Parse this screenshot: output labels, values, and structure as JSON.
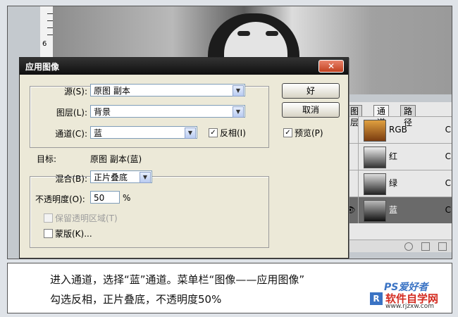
{
  "ruler_number": "6",
  "dialog": {
    "title": "应用图像",
    "close_glyph": "✕",
    "source_label": "源(S):",
    "source_value": "原图 副本",
    "layer_label": "图层(L):",
    "layer_value": "背景",
    "channel_label": "通道(C):",
    "channel_value": "蓝",
    "invert_label": "反相(I)",
    "invert_checked": true,
    "target_label": "目标:",
    "target_value": "原图 副本(蓝)",
    "blend_label": "混合(B):",
    "blend_value": "正片叠底",
    "opacity_label": "不透明度(O):",
    "opacity_value": "50",
    "opacity_unit": "%",
    "preserve_label": "保留透明区域(T)",
    "mask_label": "蒙版(K)...",
    "ok_label": "好",
    "cancel_label": "取消",
    "preview_label": "预览(P)",
    "preview_checked": true,
    "check_glyph": "✓",
    "arrow_glyph": "▼"
  },
  "panel": {
    "tabs": [
      "图层",
      "通道",
      "路径"
    ],
    "active_tab": "通道",
    "rows": [
      {
        "label": "RGB",
        "key": "C",
        "selected": false,
        "visible": false
      },
      {
        "label": "红",
        "key": "C",
        "selected": false,
        "visible": false
      },
      {
        "label": "绿",
        "key": "C",
        "selected": false,
        "visible": false
      },
      {
        "label": "蓝",
        "key": "C",
        "selected": true,
        "visible": true
      }
    ],
    "eye_glyph": "👁"
  },
  "caption": {
    "line1": "进入通道，选择“蓝”通道。菜单栏“图像——应用图像”",
    "line2": "勾选反相，正片叠底，不透明度50%"
  },
  "logo": {
    "ps_text": "PS爱好者",
    "mark": "R",
    "site": "软件自学网",
    "url": "www.rjzxw.com"
  },
  "colors": {
    "selected_row": "#6a6a6a",
    "titlebar": "#111111",
    "close_button": "#c1401f",
    "logo_blue": "#3a73c4",
    "logo_red": "#d32b20"
  }
}
